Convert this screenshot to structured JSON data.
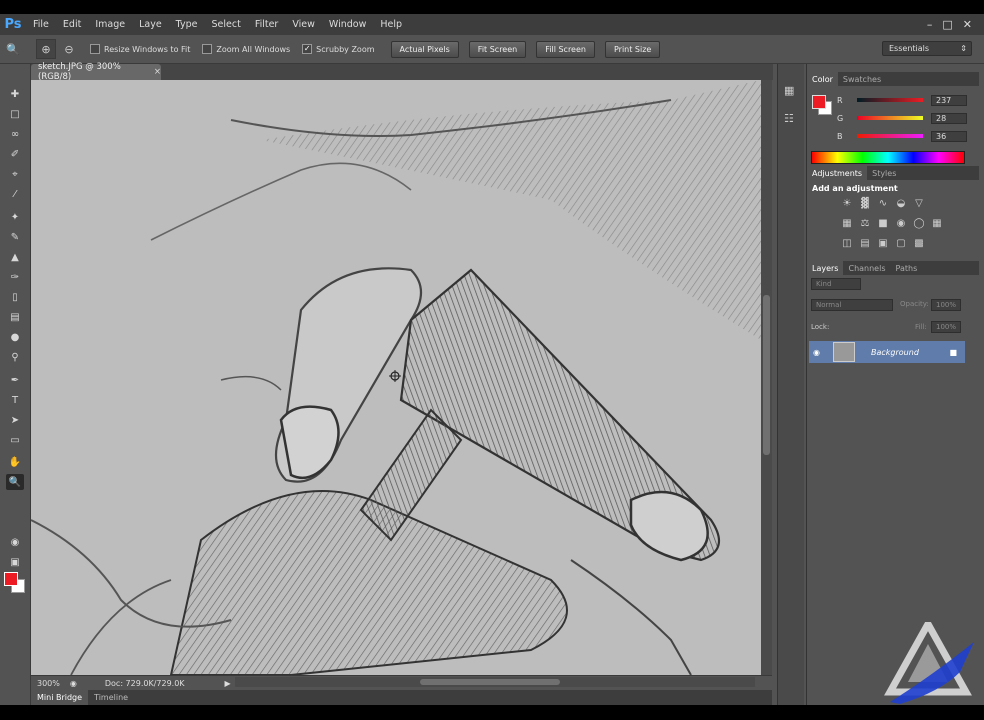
{
  "app": {
    "logo": "Ps",
    "menu": [
      "File",
      "Edit",
      "Image",
      "Laye",
      "Type",
      "Select",
      "Filter",
      "View",
      "Window",
      "Help"
    ]
  },
  "options": {
    "checkboxes": [
      {
        "label": "Resize Windows to Fit",
        "checked": false
      },
      {
        "label": "Zoom All Windows",
        "checked": false
      },
      {
        "label": "Scrubby Zoom",
        "checked": true
      }
    ],
    "buttons": [
      "Actual Pixels",
      "Fit Screen",
      "Fill Screen",
      "Print Size"
    ],
    "workspace": "Essentials"
  },
  "document": {
    "tab_title": "sketch.JPG @ 300% (RGB/8)",
    "zoom": "300%",
    "doc_size": "Doc: 729.0K/729.0K"
  },
  "bottom_tabs": [
    "Mini Bridge",
    "Timeline"
  ],
  "color_panel": {
    "tabs": [
      "Color",
      "Swatches"
    ],
    "foreground": "#ed1c24",
    "channels": [
      {
        "label": "R",
        "value": "237"
      },
      {
        "label": "G",
        "value": "28"
      },
      {
        "label": "B",
        "value": "36"
      }
    ]
  },
  "adjustments_panel": {
    "tabs": [
      "Adjustments",
      "Styles"
    ],
    "heading": "Add an adjustment"
  },
  "layers_panel": {
    "tabs": [
      "Layers",
      "Channels",
      "Paths"
    ],
    "filter": "Kind",
    "blend_mode": "Normal",
    "opacity_label": "Opacity:",
    "opacity_value": "100%",
    "lock_label": "Lock:",
    "fill_label": "Fill:",
    "fill_value": "100%",
    "layer_name": "Background"
  }
}
